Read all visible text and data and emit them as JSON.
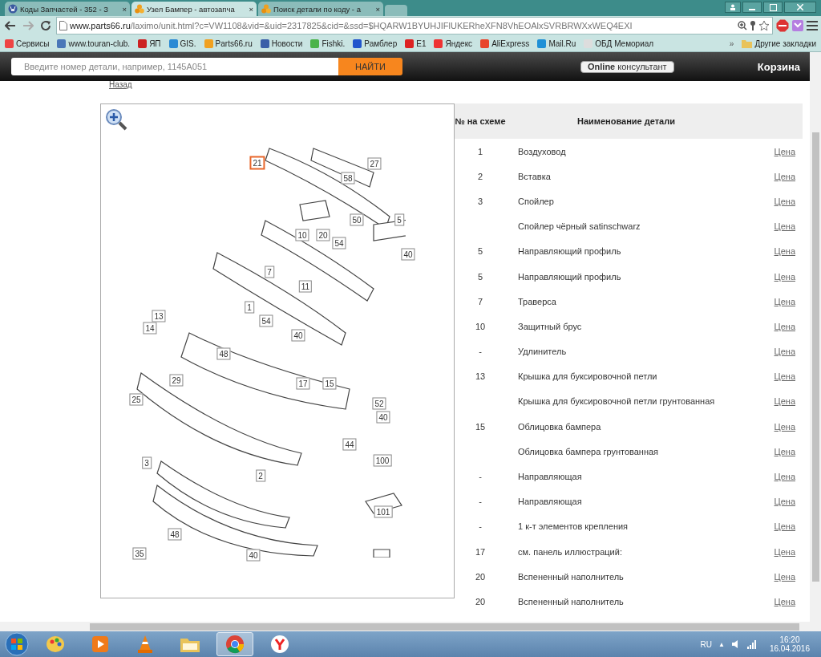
{
  "browser": {
    "tabs": [
      {
        "title": "Коды Запчастей - 352 - З",
        "selected": false,
        "kind": "vw"
      },
      {
        "title": "Узел Бампер - автозапча",
        "selected": true,
        "kind": "parts"
      },
      {
        "title": "Поиск детали по коду - а",
        "selected": false,
        "kind": "parts"
      }
    ],
    "close_glyph": "×",
    "url_host": "www.parts66.ru",
    "url_path": "/laximo/unit.html?c=VW1108&vid=&uid=2317825&cid=&ssd=$HQARW1BYUHJIFlUKERheXFN8VhEOAlxSVRBRWXxWEQ4EXI",
    "bookmarks": [
      {
        "label": "Сервисы"
      },
      {
        "label": "www.touran-club."
      },
      {
        "label": "ЯП"
      },
      {
        "label": "GIS."
      },
      {
        "label": "Parts66.ru"
      },
      {
        "label": "Новости"
      },
      {
        "label": "Fishki."
      },
      {
        "label": "Рамблер"
      },
      {
        "label": "E1"
      },
      {
        "label": "Яндекс"
      },
      {
        "label": "AliExpress"
      },
      {
        "label": "Mail.Ru"
      },
      {
        "label": "ОБД Мемориал"
      }
    ],
    "more_glyph": "»",
    "other_bookmarks": "Другие закладки"
  },
  "site_header": {
    "search_placeholder": "Введите номер детали, например, 1145A051",
    "search_button": "НАЙТИ",
    "consultant": "**Online** консультант",
    "cart": "Корзина"
  },
  "back_link": "Назад",
  "diagram": {
    "callouts": [
      {
        "label": "21",
        "selected": true
      },
      {
        "label": "27",
        "selected": false
      },
      {
        "label": "58",
        "selected": false
      },
      {
        "label": "50",
        "selected": false
      },
      {
        "label": "5",
        "selected": false
      },
      {
        "label": "10",
        "selected": false
      },
      {
        "label": "20",
        "selected": false
      },
      {
        "label": "54",
        "selected": false
      },
      {
        "label": "40",
        "selected": false
      },
      {
        "label": "7",
        "selected": false
      },
      {
        "label": "11",
        "selected": false
      },
      {
        "label": "13",
        "selected": false
      },
      {
        "label": "1",
        "selected": false
      },
      {
        "label": "14",
        "selected": false
      },
      {
        "label": "54",
        "selected": false
      },
      {
        "label": "40",
        "selected": false
      },
      {
        "label": "48",
        "selected": false
      },
      {
        "label": "29",
        "selected": false
      },
      {
        "label": "17",
        "selected": false
      },
      {
        "label": "15",
        "selected": false
      },
      {
        "label": "25",
        "selected": false
      },
      {
        "label": "52",
        "selected": false
      },
      {
        "label": "40",
        "selected": false
      },
      {
        "label": "44",
        "selected": false
      },
      {
        "label": "100",
        "selected": false
      },
      {
        "label": "3",
        "selected": false
      },
      {
        "label": "2",
        "selected": false
      },
      {
        "label": "101",
        "selected": false
      },
      {
        "label": "48",
        "selected": false
      },
      {
        "label": "35",
        "selected": false
      },
      {
        "label": "40",
        "selected": false
      }
    ]
  },
  "table": {
    "columns": [
      "№ на схеме",
      "Наименование детали"
    ],
    "rows": [
      {
        "number": "1",
        "name": "Воздуховод",
        "link": "Цена"
      },
      {
        "number": "2",
        "name": "Вставка",
        "link": "Цена"
      },
      {
        "number": "3",
        "name": "Спойлер",
        "link": "Цена"
      },
      {
        "name": "Спойлер чёрный satinschwarz",
        "link": "Цена"
      },
      {
        "number": "5",
        "name": "Направляющий профиль",
        "link": "Цена"
      },
      {
        "number": "5",
        "name": "Направляющий профиль",
        "link": "Цена"
      },
      {
        "number": "7",
        "name": "Траверса",
        "link": "Цена"
      },
      {
        "number": "10",
        "name": "Защитный брус",
        "link": "Цена"
      },
      {
        "number": "-",
        "name": "Удлинитель",
        "link": "Цена"
      },
      {
        "number": "13",
        "name": "Крышка для буксировочной петли",
        "link": "Цена"
      },
      {
        "name": "Крышка для буксировочной петли грунтованная",
        "link": "Цена"
      },
      {
        "number": "15",
        "name": "Облицовка бампера",
        "link": "Цена"
      },
      {
        "name": "Облицовка бампера грунтованная",
        "link": "Цена"
      },
      {
        "number": "-",
        "name": "Направляющая",
        "link": "Цена"
      },
      {
        "number": "-",
        "name": "Направляющая",
        "link": "Цена"
      },
      {
        "number": "-",
        "name": "1 к-т элементов крепления",
        "link": "Цена"
      },
      {
        "number": "17",
        "name": "см. панель иллюстраций:",
        "link": "Цена"
      },
      {
        "number": "20",
        "name": "Вспененный наполнитель",
        "link": "Цена"
      },
      {
        "number": "20",
        "name": "Вспененный наполнитель",
        "link": "Цена"
      }
    ]
  },
  "taskbar": {
    "apps": [
      {
        "kind": "paint",
        "selected": false
      },
      {
        "kind": "media",
        "selected": false
      },
      {
        "kind": "vlc",
        "selected": false
      },
      {
        "kind": "folder",
        "selected": false
      },
      {
        "kind": "chrome",
        "selected": true
      },
      {
        "kind": "yandex",
        "selected": false
      }
    ],
    "language": "RU",
    "tray_glyph": "▲",
    "time": "16:20",
    "date": "16.04.2016"
  }
}
